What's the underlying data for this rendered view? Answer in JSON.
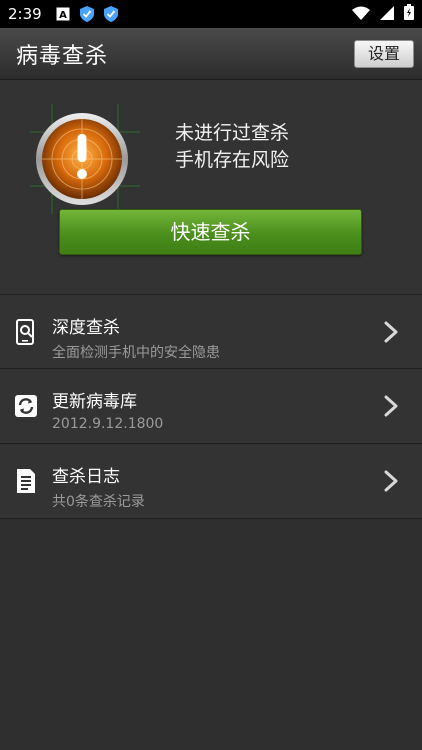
{
  "status_bar": {
    "time": "2:39",
    "icons": [
      "notification-a-icon",
      "shield-icon",
      "shield-icon"
    ],
    "right_icons": [
      "wifi-icon",
      "signal-icon",
      "battery-icon"
    ]
  },
  "header": {
    "title": "病毒查杀",
    "settings_label": "设置"
  },
  "hero": {
    "status_line1": "未进行过查杀",
    "status_line2": "手机存在风险",
    "scan_button_label": "快速查杀",
    "accent_color": "#e07a10",
    "button_color": "#5a9e25"
  },
  "menu": {
    "items": [
      {
        "title": "深度查杀",
        "subtitle": "全面检测手机中的安全隐患",
        "icon": "phone-search-icon"
      },
      {
        "title": "更新病毒库",
        "subtitle": "2012.9.12.1800",
        "icon": "refresh-icon"
      },
      {
        "title": "查杀日志",
        "subtitle": "共0条查杀记录",
        "icon": "document-icon"
      }
    ]
  }
}
